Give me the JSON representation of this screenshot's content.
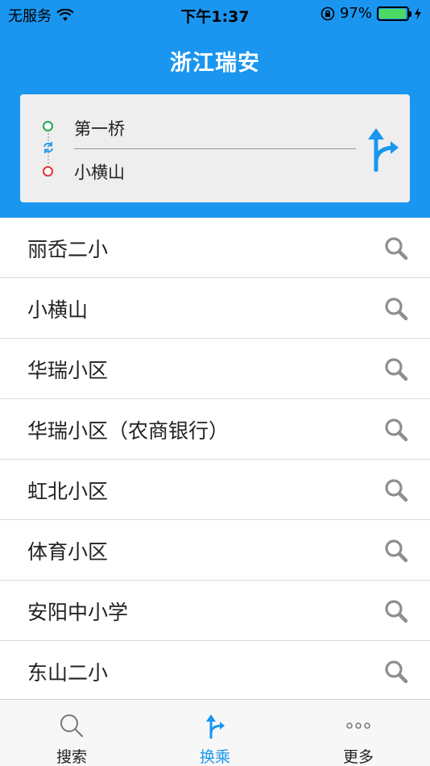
{
  "status_bar": {
    "carrier": "无服务",
    "time": "下午1:37",
    "battery": "97%",
    "battery_level": 0.97
  },
  "header": {
    "title": "浙江瑞安"
  },
  "route": {
    "from": "第一桥",
    "to": "小横山"
  },
  "stops": [
    {
      "label": "丽岙二小"
    },
    {
      "label": "小横山"
    },
    {
      "label": "华瑞小区"
    },
    {
      "label": "华瑞小区（农商银行）"
    },
    {
      "label": "虹北小区"
    },
    {
      "label": "体育小区"
    },
    {
      "label": "安阳中小学"
    },
    {
      "label": "东山二小"
    }
  ],
  "tabs": [
    {
      "label": "搜索",
      "icon": "search-icon",
      "active": false
    },
    {
      "label": "换乘",
      "icon": "transfer-icon",
      "active": true
    },
    {
      "label": "更多",
      "icon": "more-icon",
      "active": false
    }
  ],
  "colors": {
    "brand": "#1a96f0",
    "start_dot": "#23a94a",
    "end_dot": "#e8333c",
    "battery": "#4cd964"
  }
}
